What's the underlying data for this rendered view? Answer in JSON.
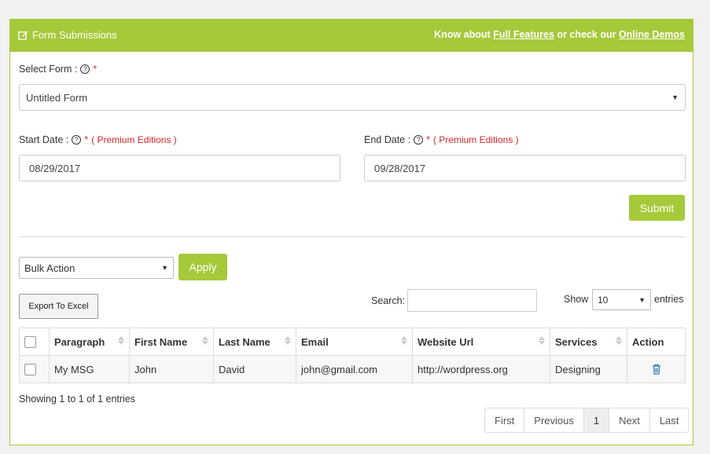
{
  "header": {
    "title": "Form Submissions",
    "know_about": "Know about",
    "full_features": "Full Features",
    "or_check": "or check our",
    "online_demos": "Online Demos"
  },
  "select_form": {
    "label": "Select Form :",
    "required": "*",
    "value": "Untitled Form"
  },
  "start_date": {
    "label": "Start Date :",
    "required": "*",
    "premium": "( Premium Editions )",
    "value": "08/29/2017"
  },
  "end_date": {
    "label": "End Date :",
    "required": "*",
    "premium": "( Premium Editions )",
    "value": "09/28/2017"
  },
  "submit_label": "Submit",
  "bulk": {
    "value": "Bulk Action",
    "apply_label": "Apply"
  },
  "export_label": "Export To Excel",
  "search": {
    "label": "Search:",
    "value": ""
  },
  "show": {
    "label": "Show",
    "value": "10",
    "suffix": "entries"
  },
  "table": {
    "columns": [
      "Paragraph",
      "First Name",
      "Last Name",
      "Email",
      "Website Url",
      "Services",
      "Action"
    ],
    "rows": [
      {
        "paragraph": "My MSG",
        "first_name": "John",
        "last_name": "David",
        "email": "john@gmail.com",
        "website": "http://wordpress.org",
        "services": "Designing"
      }
    ]
  },
  "info": "Showing 1 to 1 of 1 entries",
  "pagination": {
    "first": "First",
    "previous": "Previous",
    "page": "1",
    "next": "Next",
    "last": "Last"
  },
  "colors": {
    "accent": "#a6c93a",
    "required": "#d9262b",
    "trash": "#2a7ab8"
  }
}
